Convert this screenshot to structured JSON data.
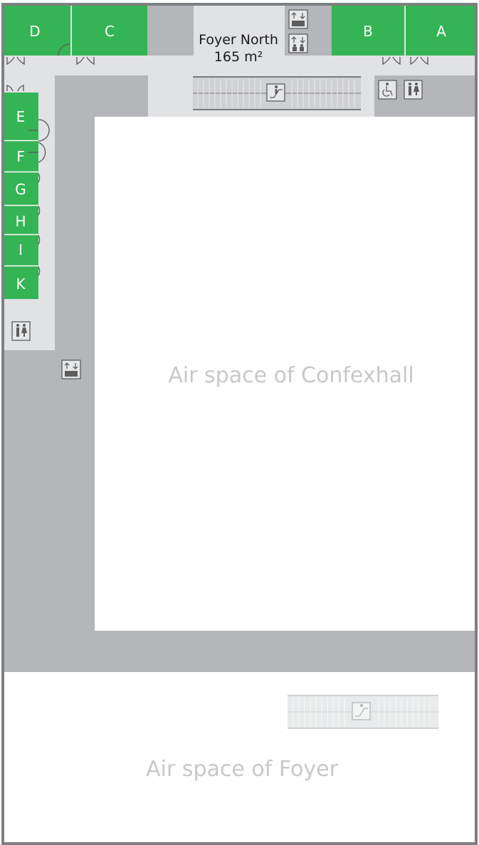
{
  "rooms": {
    "a": "A",
    "b": "B",
    "c": "C",
    "d": "D",
    "e": "E",
    "f": "F",
    "g": "G",
    "h": "H",
    "i": "I",
    "k": "K"
  },
  "foyer_north": {
    "name": "Foyer North",
    "area": "165 m²"
  },
  "air_space_confexhall": "Air space of Confexhall",
  "air_space_foyer": "Air space of Foyer",
  "icons": [
    "elevator-icon",
    "freight-elevator-icon",
    "escalator-icon",
    "accessible-toilet-icon",
    "restroom-icon"
  ],
  "colors": {
    "room": "#34b454",
    "corridor": "#b5b6b9",
    "foyer": "#e1e2e4",
    "air_space": "#ffffff",
    "outline": "#7e7f82"
  }
}
